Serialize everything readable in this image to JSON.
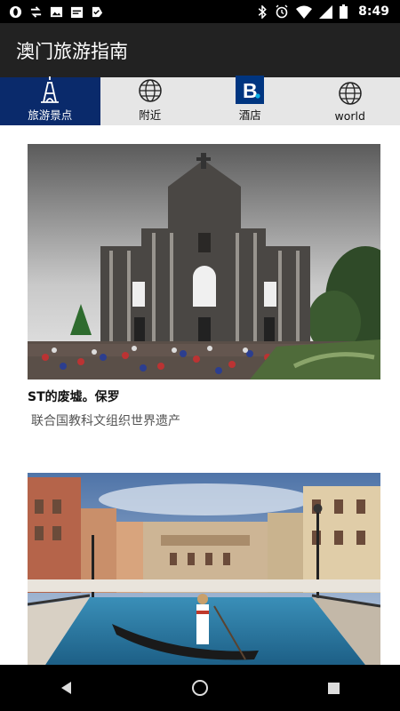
{
  "status_bar": {
    "time": "8:49",
    "left_icons": [
      "opera-icon",
      "arrows-icon",
      "image-icon",
      "calendar-icon",
      "check-icon"
    ],
    "right_icons": [
      "bluetooth-icon",
      "alarm-icon",
      "wifi-icon",
      "signal-icon",
      "battery-icon"
    ]
  },
  "app_bar": {
    "title": "澳门旅游指南"
  },
  "tabs": [
    {
      "label": "旅游景点",
      "icon": "eiffel-tower-icon",
      "active": true
    },
    {
      "label": "附近",
      "icon": "globe-icon",
      "active": false
    },
    {
      "label": "酒店",
      "icon": "booking-icon",
      "active": false
    },
    {
      "label": "world",
      "icon": "globe-icon",
      "active": false
    }
  ],
  "cards": [
    {
      "title": "ST的废墟。保罗",
      "subtitle": "联合国教科文组织世界遗产",
      "image": "ruins-of-st-paul-photo"
    },
    {
      "title": "",
      "subtitle": "",
      "image": "venetian-macao-canal-photo"
    }
  ],
  "nav": {
    "back": "back-icon",
    "home": "home-icon",
    "recents": "recents-icon"
  },
  "colors": {
    "tab_active": "#0a2a6b",
    "app_bar": "#222222",
    "tab_bar": "#e6e6e6",
    "booking_blue": "#003580"
  }
}
